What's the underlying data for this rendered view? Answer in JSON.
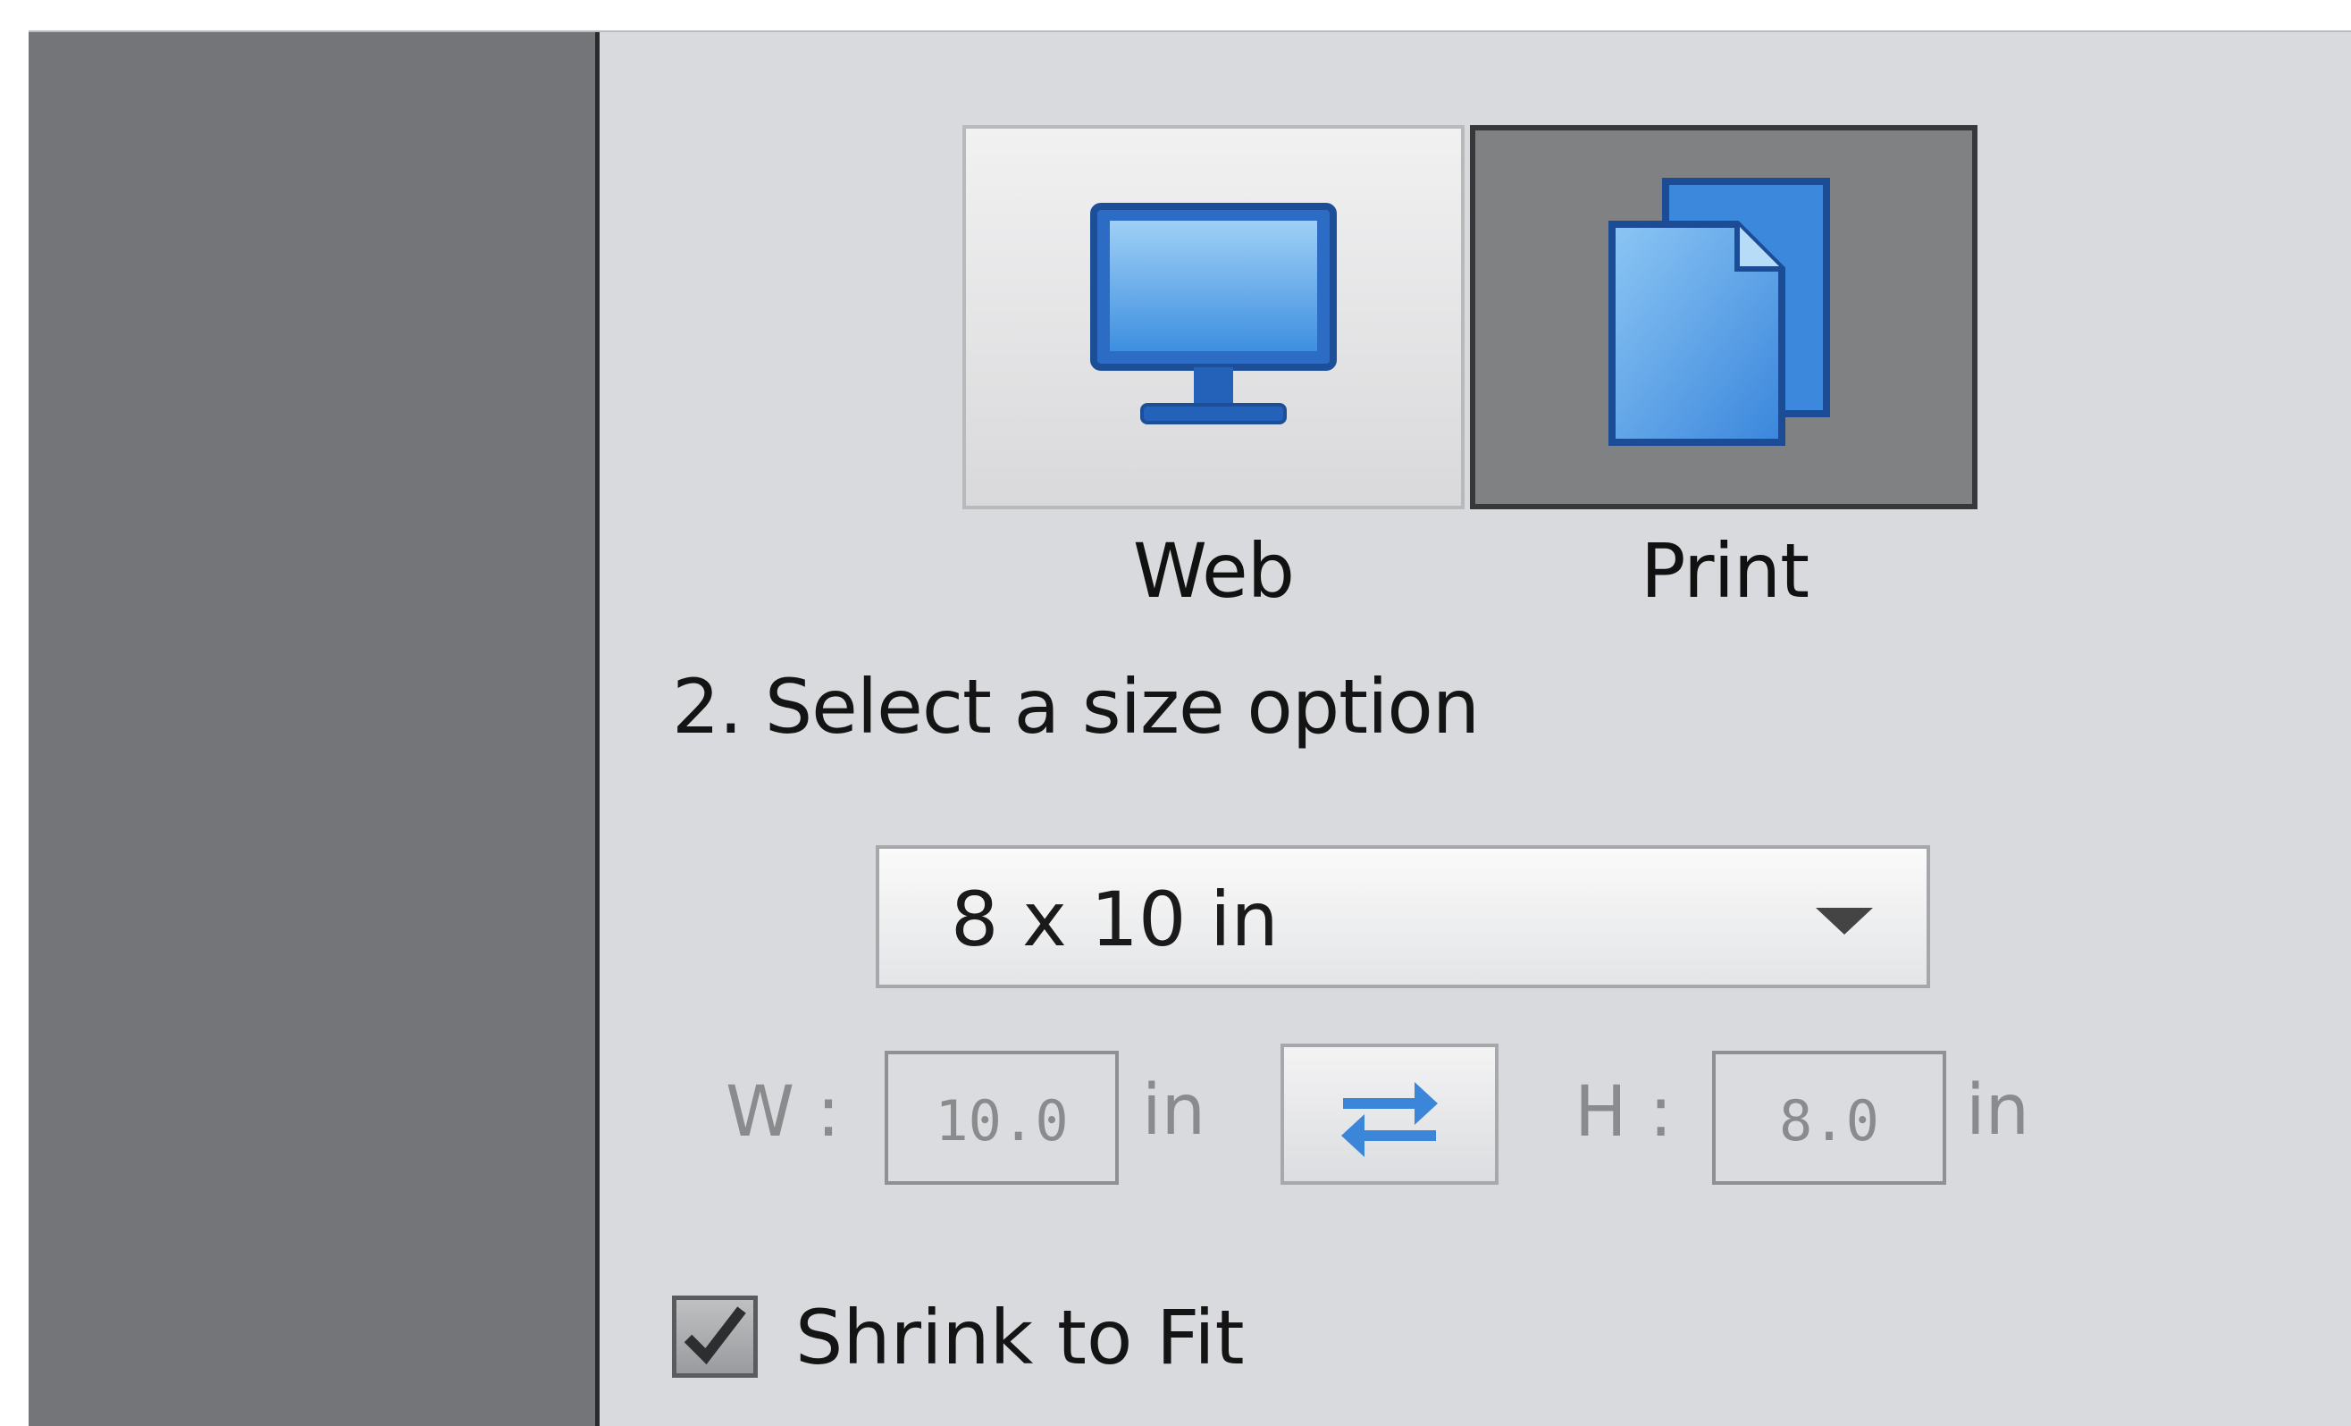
{
  "mode_buttons": {
    "web": {
      "label": "Web",
      "icon": "monitor-icon",
      "selected": false
    },
    "print": {
      "label": "Print",
      "icon": "documents-icon",
      "selected": true
    }
  },
  "step_heading": "2. Select a size option",
  "size_select": {
    "value": "8 x 10 in",
    "icon": "chevron-down-icon"
  },
  "dimensions": {
    "width_label": "W :",
    "width_value": "10.0",
    "width_unit": "in",
    "height_label": "H :",
    "height_value": "8.0",
    "height_unit": "in",
    "swap_icon": "swap-arrows-icon"
  },
  "shrink_to_fit": {
    "label": "Shrink to Fit",
    "checked": true
  },
  "colors": {
    "sidebar": "#747578",
    "panel": "#d8dadd",
    "icon_blue": "#3a8ee0",
    "icon_outline": "#1f4f9a",
    "selected_button": "#808183"
  }
}
